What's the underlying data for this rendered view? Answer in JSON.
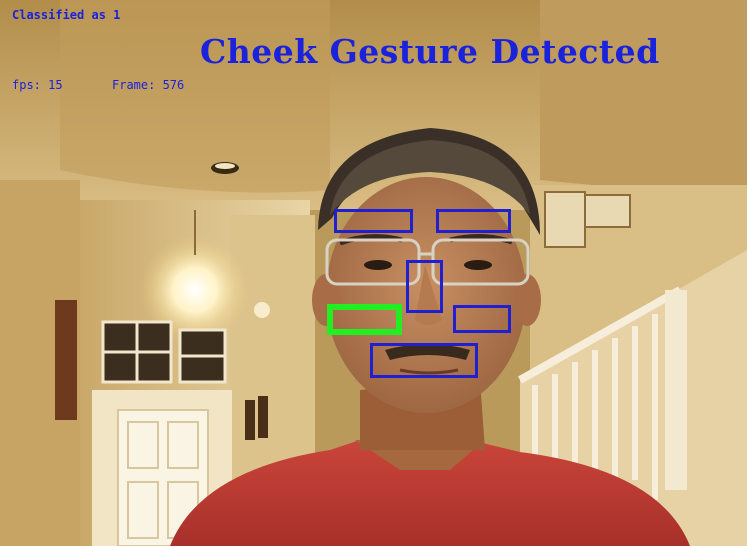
{
  "status": {
    "classified": "Classified as 1",
    "fps": "fps: 15",
    "frame": "Frame: 576"
  },
  "gesture_banner": "Cheek Gesture Detected",
  "detection_boxes": [
    {
      "name": "left-eyebrow-box",
      "active": false
    },
    {
      "name": "right-eyebrow-box",
      "active": false
    },
    {
      "name": "nose-box",
      "active": false
    },
    {
      "name": "left-cheek-box",
      "active": true
    },
    {
      "name": "right-cheek-box",
      "active": false
    },
    {
      "name": "mouth-box",
      "active": false
    }
  ],
  "colors": {
    "overlay_text": "#1a22dc",
    "box_default": "#2020d0",
    "box_active": "#22ee22"
  }
}
